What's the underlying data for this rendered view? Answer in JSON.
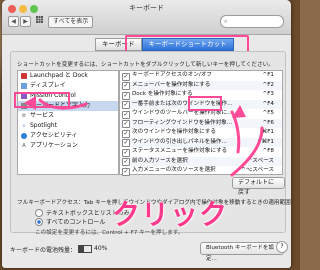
{
  "window": {
    "title": "キーボード"
  },
  "toolbar": {
    "show_all": "すべてを表示"
  },
  "tabs": [
    {
      "label": "キーボード"
    },
    {
      "label": "キーボードショートカット"
    }
  ],
  "description": "ショートカットを変更するには、ショートカットをダブルクリックして新しいキーを押してください。",
  "categories": [
    {
      "label": "Launchpad と Dock",
      "icon": "launchpad-icon"
    },
    {
      "label": "ディスプレイ",
      "icon": "display-icon"
    },
    {
      "label": "Mission Control",
      "icon": "mission-control-icon"
    },
    {
      "label": "キーボードと文字入力",
      "icon": "keyboard-icon"
    },
    {
      "label": "サービス",
      "icon": "gear-icon"
    },
    {
      "label": "Spotlight",
      "icon": "spotlight-icon"
    },
    {
      "label": "アクセシビリティ",
      "icon": "accessibility-icon"
    },
    {
      "label": "アプリケーション",
      "icon": "app-icon"
    }
  ],
  "shortcuts": [
    {
      "label": "キーボードアクセスのオン/オフ",
      "key": "^F1",
      "checked": true
    },
    {
      "label": "メニューバーを操作対象にする",
      "key": "^F2",
      "checked": true
    },
    {
      "label": "Dock を操作対象にする",
      "key": "^F3",
      "checked": true
    },
    {
      "label": "一番手前または次のウインドウを操作...",
      "key": "^F4",
      "checked": true
    },
    {
      "label": "ウインドウのツールバーを操作対象に...",
      "key": "^F5",
      "checked": true
    },
    {
      "label": "フローティングウインドウを操作対象...",
      "key": "^F6",
      "checked": true
    },
    {
      "label": "次のウインドウを操作対象にする",
      "key": "⌘F1",
      "checked": true
    },
    {
      "label": "ウインドウの引き出しパネルを操作...",
      "key": "^⌘F1",
      "checked": true
    },
    {
      "label": "ステータスメニューを操作対象にする",
      "key": "^F8",
      "checked": true
    },
    {
      "label": "前の入力ソースを選択",
      "key": "^スペース",
      "checked": true
    },
    {
      "label": "入力メニューの次のソースを選択",
      "key": "^⌥スペース",
      "checked": true
    }
  ],
  "default_button": "デフォルトに戻す",
  "full_keyboard_access": "フルキーボードアクセス：Tab キーを押してウインドウやダイアログ内で操作対象を移動するときの適用範囲：",
  "radio_options": [
    {
      "label": "テキストボックスとリストのみ",
      "selected": false
    },
    {
      "label": "すべてのコントロール",
      "selected": true
    }
  ],
  "hint": "この設定を変更するには、Control + F7 キーを押します。",
  "battery": {
    "label": "キーボードの電池残量：",
    "percent": 40,
    "percent_text": "40%"
  },
  "bluetooth_button": "Bluetooth キーボードを設定...",
  "annotation": {
    "text": "クリック"
  },
  "colors": {
    "highlight": "#ff4a97",
    "accent": "#2d72d9"
  }
}
